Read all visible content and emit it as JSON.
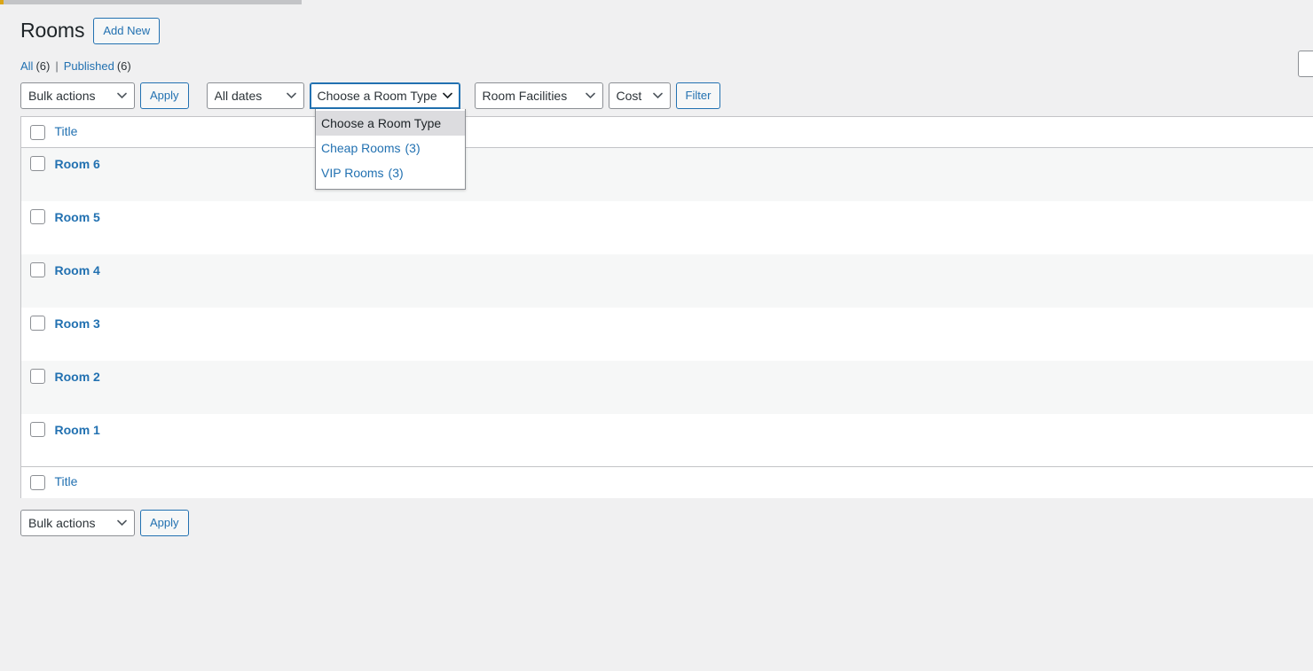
{
  "page": {
    "title": "Rooms",
    "add_new_label": "Add New"
  },
  "status_links": {
    "all_label": "All",
    "all_count": "(6)",
    "separator": "|",
    "published_label": "Published",
    "published_count": "(6)"
  },
  "search": {
    "value": "",
    "placeholder": ""
  },
  "toolbar_top": {
    "bulk_actions_value": "Bulk actions",
    "apply_label": "Apply",
    "all_dates_value": "All dates",
    "room_type_value": "Choose a Room Type",
    "room_facilities_value": "Room Facilities",
    "cost_value": "Cost",
    "filter_label": "Filter"
  },
  "room_type_dropdown": {
    "open": true,
    "options": [
      {
        "label": "Choose a Room Type",
        "count": "",
        "selected": true
      },
      {
        "label": "Cheap Rooms",
        "count": "(3)",
        "selected": false
      },
      {
        "label": "VIP Rooms",
        "count": "(3)",
        "selected": false
      }
    ]
  },
  "table": {
    "header_title": "Title",
    "footer_title": "Title",
    "rows": [
      {
        "title": "Room 6"
      },
      {
        "title": "Room 5"
      },
      {
        "title": "Room 4"
      },
      {
        "title": "Room 3"
      },
      {
        "title": "Room 2"
      },
      {
        "title": "Room 1"
      }
    ]
  },
  "toolbar_bottom": {
    "bulk_actions_value": "Bulk actions",
    "apply_label": "Apply"
  },
  "colors": {
    "link": "#2271b1",
    "text": "#1d2327",
    "page_bg": "#f0f0f1",
    "row_alt_bg": "#f6f7f7",
    "border": "#c3c4c7",
    "notice_accent": "#dba617",
    "dropdown_selected_bg": "#dcdcdf"
  }
}
